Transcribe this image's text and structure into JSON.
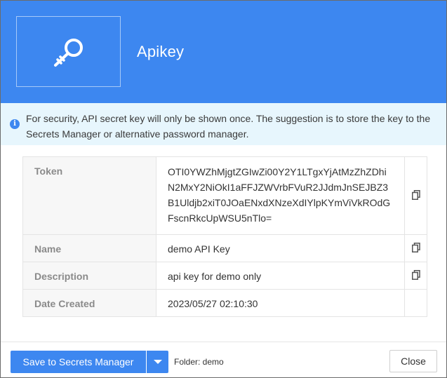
{
  "header": {
    "title": "Apikey",
    "background_color": "#3d87f0",
    "icon": "key-icon"
  },
  "alert": {
    "icon": "info-icon",
    "text": "For security, API secret key will only be shown once. The suggestion is to store the key to the Secrets Manager or alternative password manager.",
    "background_color": "#e7f6fd"
  },
  "details": {
    "rows": [
      {
        "label": "Token",
        "value": "OTI0YWZhMjgtZGIwZi00Y2Y1LTgxYjAtMzZhZDhiN2MxY2NiOkI1aFFJZWVrbFVuR2JJdmJnSEJBZ3B1Uldjb2xiT0JOaENxdXNzeXdIYlpKYmViVkROdGFscnRkcUpWSU5nTlo=",
        "copy_icon": "copy-icon"
      },
      {
        "label": "Name",
        "value": "demo API Key",
        "copy_icon": "copy-icon"
      },
      {
        "label": "Description",
        "value": "api key for demo only",
        "copy_icon": "copy-icon"
      },
      {
        "label": "Date Created",
        "value": "2023/05/27 02:10:30"
      }
    ]
  },
  "footer": {
    "save_label": "Save to Secrets Manager",
    "dropdown_icon": "caret-down-icon",
    "folder_text": "Folder: demo",
    "close_label": "Close",
    "primary_color": "#3d87f0"
  }
}
